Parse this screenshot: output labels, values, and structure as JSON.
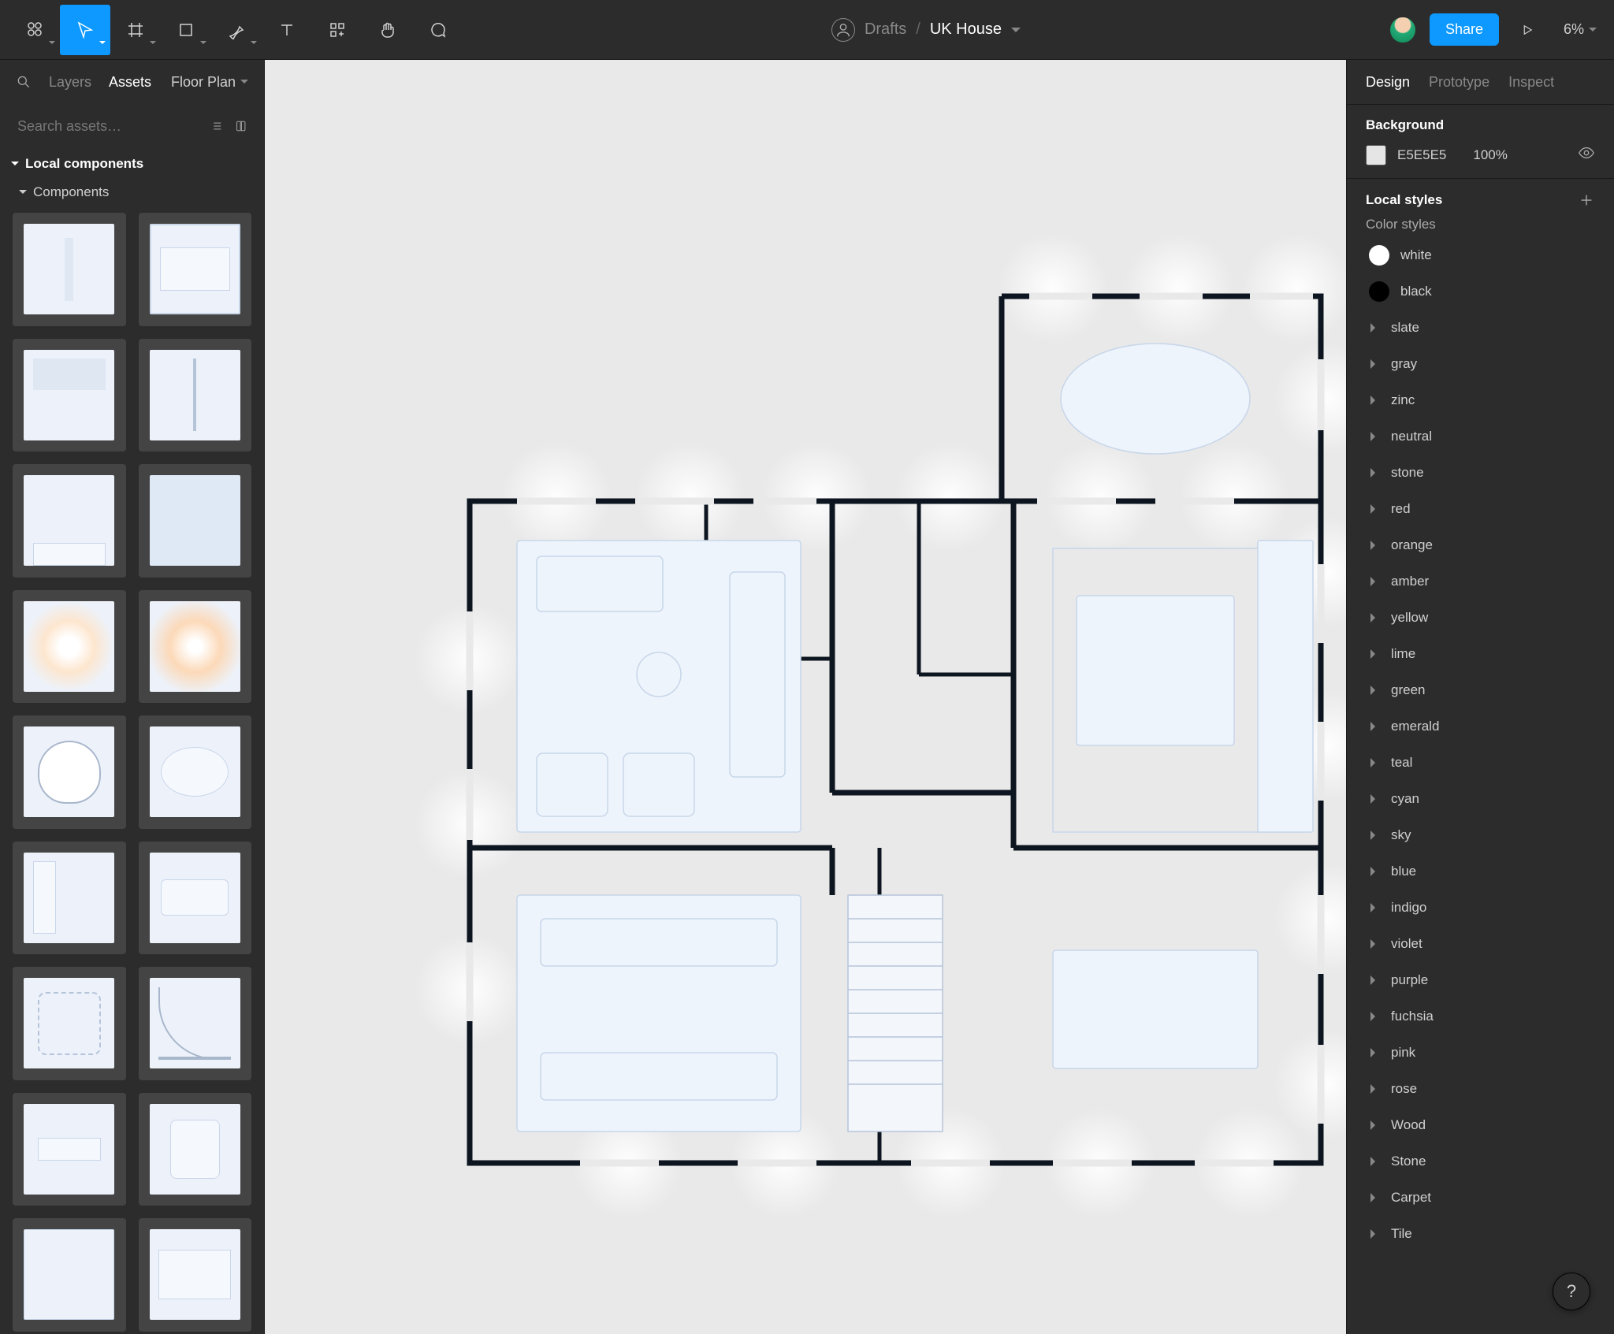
{
  "toolbar": {
    "file_breadcrumb": {
      "drafts": "Drafts",
      "file": "UK House"
    },
    "share_label": "Share",
    "zoom": "6%"
  },
  "left_panel": {
    "tabs": {
      "layers": "Layers",
      "assets": "Assets",
      "page": "Floor Plan"
    },
    "search_placeholder": "Search assets…",
    "section_title": "Local components",
    "sub_title": "Components"
  },
  "right_panel": {
    "tabs": {
      "design": "Design",
      "prototype": "Prototype",
      "inspect": "Inspect"
    },
    "background_title": "Background",
    "background": {
      "hex": "E5E5E5",
      "opacity": "100%"
    },
    "local_styles_title": "Local styles",
    "color_styles_title": "Color styles",
    "swatches": {
      "white": "white",
      "black": "black"
    },
    "groups": [
      "slate",
      "gray",
      "zinc",
      "neutral",
      "stone",
      "red",
      "orange",
      "amber",
      "yellow",
      "lime",
      "green",
      "emerald",
      "teal",
      "cyan",
      "sky",
      "blue",
      "indigo",
      "violet",
      "purple",
      "fuchsia",
      "pink",
      "rose",
      "Wood",
      "Stone",
      "Carpet",
      "Tile"
    ]
  },
  "help": "?"
}
